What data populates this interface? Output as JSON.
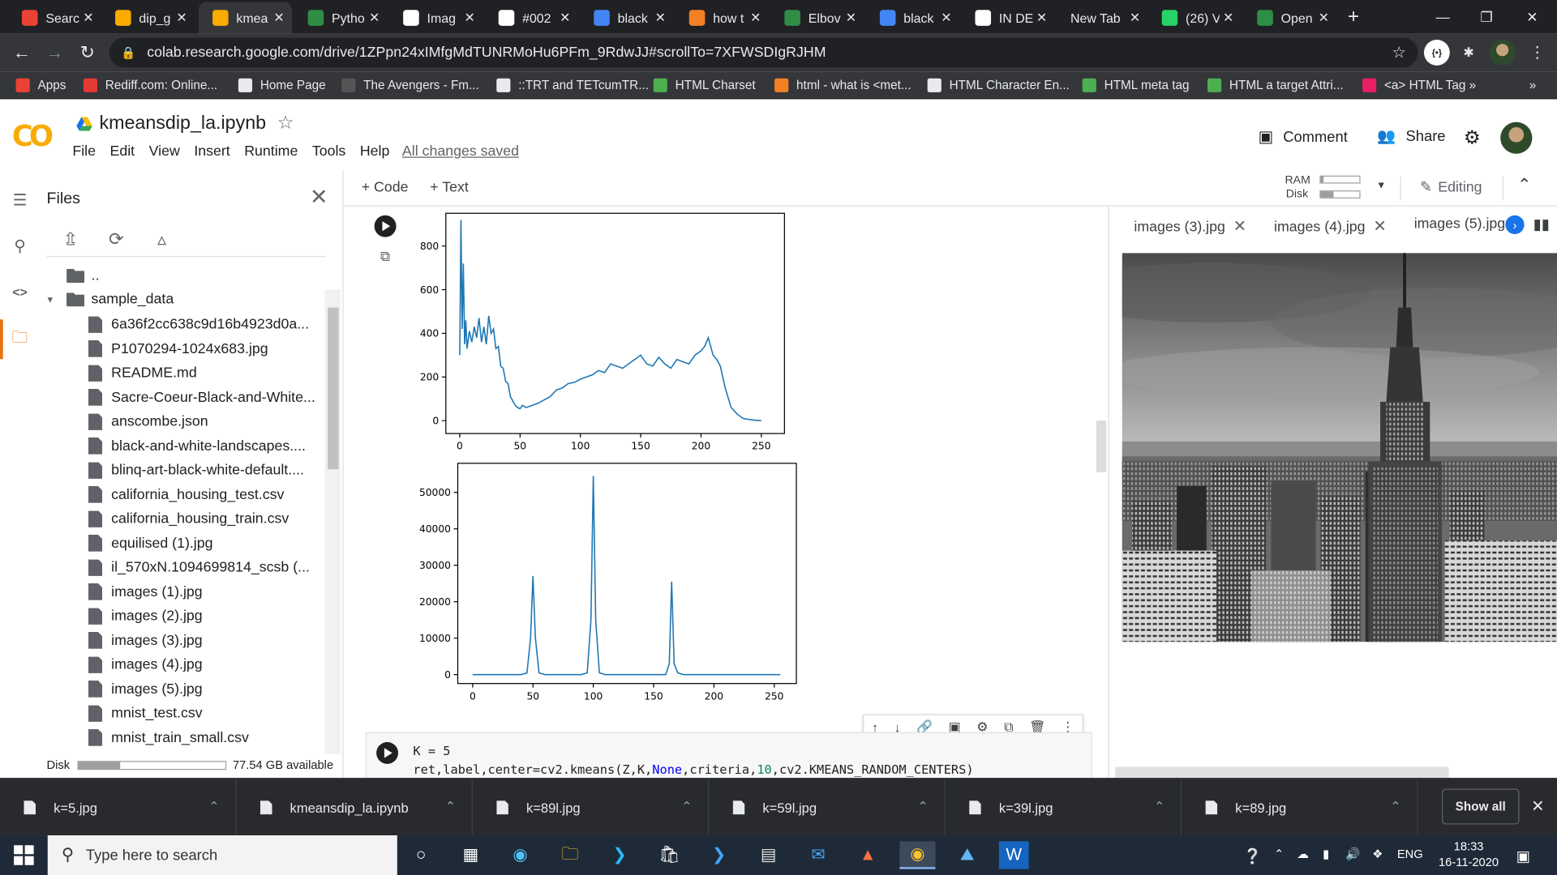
{
  "browser": {
    "tabs": [
      {
        "label": "Searc",
        "icon": "gmail-icon",
        "color": "#ea4335"
      },
      {
        "label": "dip_g",
        "icon": "colab-icon",
        "color": "#f9ab00"
      },
      {
        "label": "kmea",
        "icon": "colab-icon",
        "color": "#f9ab00",
        "active": true
      },
      {
        "label": "Pytho",
        "icon": "geeks-icon",
        "color": "#2f8d46"
      },
      {
        "label": "Imag",
        "icon": "github-icon",
        "color": "#ffffff"
      },
      {
        "label": "#002",
        "icon": "hash-icon",
        "color": "#ffffff"
      },
      {
        "label": "black",
        "icon": "google-icon",
        "color": "#4285f4"
      },
      {
        "label": "how t",
        "icon": "stackoverflow-icon",
        "color": "#f48024"
      },
      {
        "label": "Elbov",
        "icon": "geeks-icon",
        "color": "#2f8d46"
      },
      {
        "label": "black",
        "icon": "google-icon",
        "color": "#4285f4"
      },
      {
        "label": "IN DE",
        "icon": "wordpress-icon",
        "color": "#ffffff"
      },
      {
        "label": "New Tab",
        "icon": "",
        "color": ""
      },
      {
        "label": "(26) V",
        "icon": "whatsapp-icon",
        "color": "#25d366"
      },
      {
        "label": "Open",
        "icon": "geeks-icon",
        "color": "#2f8d46"
      }
    ],
    "new_tab": "+",
    "url": "colab.research.google.com/drive/1ZPpn24xIMfgMdTUNRMoHu6PFm_9RdwJJ#scrollTo=7XFWSDIgRJHM",
    "bookmarks": [
      {
        "label": "Apps",
        "icon": "apps-icon",
        "color": "#ea4335"
      },
      {
        "label": "Rediff.com: Online...",
        "icon": "rediff-icon",
        "color": "#e53935"
      },
      {
        "label": "Home Page",
        "icon": "globe-icon",
        "color": "#e8eaed"
      },
      {
        "label": "The Avengers - Fm...",
        "icon": "film-icon",
        "color": "#555555"
      },
      {
        "label": "::TRT and TETcumTR...",
        "icon": "globe-icon",
        "color": "#e8eaed"
      },
      {
        "label": "HTML Charset",
        "icon": "w3-icon",
        "color": "#4caf50"
      },
      {
        "label": "html - what is <met...",
        "icon": "stackoverflow-icon",
        "color": "#f48024"
      },
      {
        "label": "HTML Character En...",
        "icon": "diamond-icon",
        "color": "#e8eaed"
      },
      {
        "label": "HTML meta tag",
        "icon": "w3-icon",
        "color": "#4caf50"
      },
      {
        "label": "HTML a target Attri...",
        "icon": "w3-icon",
        "color": "#4caf50"
      },
      {
        "label": "<a> HTML Tag »",
        "icon": "h-icon",
        "color": "#e91e63"
      }
    ],
    "more_bookmarks": "»"
  },
  "colab": {
    "logo": "CO",
    "title": "kmeansdip_la.ipynb",
    "menu": [
      "File",
      "Edit",
      "View",
      "Insert",
      "Runtime",
      "Tools",
      "Help"
    ],
    "saved_status": "All changes saved",
    "comment_label": "Comment",
    "share_label": "Share",
    "add_code": "+ Code",
    "add_text": "+ Text",
    "ram_label": "RAM",
    "disk_label": "Disk",
    "editing_label": "Editing"
  },
  "files_panel": {
    "title": "Files",
    "parent": "..",
    "folder": "sample_data",
    "files": [
      "6a36f2cc638c9d16b4923d0a...",
      "P1070294-1024x683.jpg",
      "README.md",
      "Sacre-Coeur-Black-and-White...",
      "anscombe.json",
      "black-and-white-landscapes....",
      "blinq-art-black-white-default....",
      "california_housing_test.csv",
      "california_housing_train.csv",
      "equilised (1).jpg",
      "il_570xN.1094699814_scsb (...",
      "images (1).jpg",
      "images (2).jpg",
      "images (3).jpg",
      "images (4).jpg",
      "images (5).jpg",
      "mnist_test.csv",
      "mnist_train_small.csv"
    ],
    "disk_label": "Disk",
    "disk_available": "77.54 GB available",
    "disk_used_fraction": 0.28
  },
  "chart_data": [
    {
      "type": "line",
      "xlim": [
        0,
        256
      ],
      "ylim": [
        0,
        900
      ],
      "xticks": [
        0,
        50,
        100,
        150,
        200,
        250
      ],
      "yticks": [
        0,
        200,
        400,
        600,
        800
      ],
      "x": [
        0,
        1,
        2,
        3,
        4,
        5,
        6,
        8,
        10,
        12,
        14,
        16,
        18,
        20,
        22,
        24,
        26,
        28,
        30,
        32,
        34,
        36,
        38,
        40,
        42,
        44,
        46,
        48,
        50,
        52,
        55,
        60,
        65,
        70,
        75,
        80,
        85,
        90,
        95,
        100,
        105,
        110,
        115,
        120,
        125,
        130,
        135,
        140,
        145,
        150,
        155,
        160,
        165,
        170,
        175,
        180,
        185,
        190,
        195,
        200,
        203,
        206,
        208,
        210,
        213,
        216,
        220,
        225,
        230,
        235,
        240,
        245,
        250
      ],
      "values": [
        300,
        920,
        420,
        720,
        350,
        460,
        330,
        410,
        360,
        430,
        380,
        470,
        360,
        430,
        350,
        480,
        400,
        420,
        330,
        340,
        250,
        240,
        180,
        170,
        110,
        90,
        70,
        60,
        55,
        70,
        60,
        70,
        80,
        95,
        110,
        140,
        150,
        170,
        175,
        190,
        200,
        210,
        230,
        220,
        260,
        250,
        240,
        260,
        280,
        300,
        260,
        250,
        290,
        260,
        240,
        280,
        270,
        260,
        300,
        320,
        340,
        380,
        340,
        300,
        280,
        250,
        150,
        60,
        30,
        10,
        5,
        2,
        0
      ]
    },
    {
      "type": "line",
      "xlim": [
        0,
        256
      ],
      "ylim": [
        0,
        55000
      ],
      "xticks": [
        0,
        50,
        100,
        150,
        200,
        250
      ],
      "yticks": [
        0,
        10000,
        20000,
        30000,
        40000,
        50000
      ],
      "x": [
        0,
        40,
        45,
        48,
        50,
        52,
        55,
        60,
        90,
        95,
        98,
        100,
        102,
        105,
        110,
        160,
        163,
        165,
        167,
        170,
        175,
        255
      ],
      "values": [
        0,
        0,
        500,
        10000,
        27000,
        10000,
        500,
        0,
        0,
        500,
        15000,
        54500,
        15000,
        500,
        0,
        0,
        3000,
        25500,
        3000,
        500,
        0,
        0
      ]
    }
  ],
  "notebook": {
    "code_line1": "K = 5",
    "code_line2_prefix": "ret,label,center=cv2.kmeans(Z,K,",
    "code_line2_kw": "None",
    "code_line2_mid": ",criteria,",
    "code_line2_num": "10",
    "code_line2_suffix": ",cv2.KMEANS_RANDOM_CENTERS)"
  },
  "viewer": {
    "tabs": [
      "images (3).jpg",
      "images (4).jpg",
      "images (5).jpg"
    ]
  },
  "downloads": {
    "items": [
      "k=5.jpg",
      "kmeansdip_la.ipynb",
      "k=89l.jpg",
      "k=59l.jpg",
      "k=39l.jpg",
      "k=89.jpg"
    ],
    "show_all": "Show all"
  },
  "taskbar": {
    "search_placeholder": "Type here to search",
    "language": "ENG",
    "time": "18:33",
    "date": "16-11-2020"
  }
}
